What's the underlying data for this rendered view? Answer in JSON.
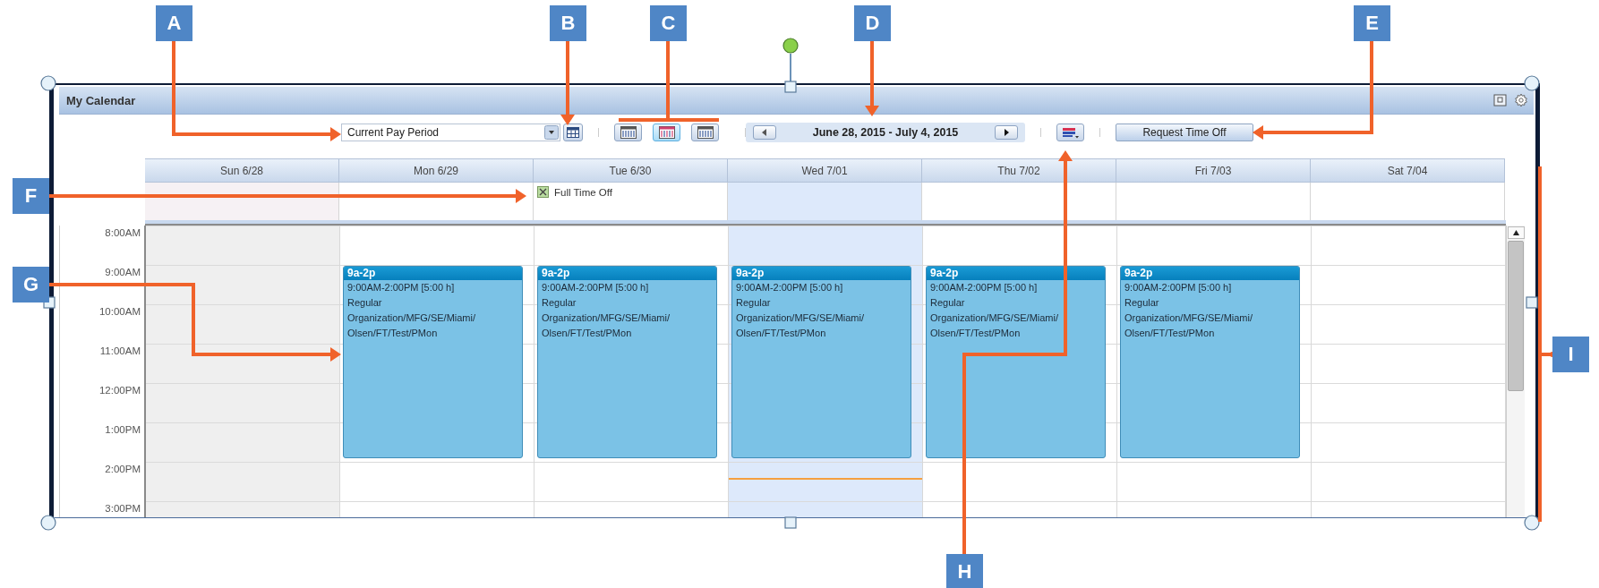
{
  "window": {
    "title": "My Calendar"
  },
  "toolbar": {
    "period_select": {
      "value": "Current Pay Period"
    },
    "view_buttons": [
      {
        "selected": false
      },
      {
        "selected": true
      },
      {
        "selected": false
      }
    ],
    "date_range": "June 28, 2015 - July 4, 2015",
    "request_button": "Request Time Off"
  },
  "calendar": {
    "days": [
      {
        "label": "Sun 6/28",
        "shaded": true,
        "selected": false
      },
      {
        "label": "Mon 6/29",
        "shaded": false,
        "selected": false,
        "events": [
          {
            "title": "9a-2p",
            "lines": [
              "9:00AM-2:00PM [5:00 h]",
              "Regular",
              "Organization/MFG/SE/Miami/",
              "Olsen/FT/Test/PMon"
            ]
          }
        ]
      },
      {
        "label": "Tue 6/30",
        "shaded": false,
        "selected": false,
        "all_day": [
          "Full Time Off"
        ],
        "events": [
          {
            "title": "9a-2p",
            "lines": [
              "9:00AM-2:00PM [5:00 h]",
              "Regular",
              "Organization/MFG/SE/Miami/",
              "Olsen/FT/Test/PMon"
            ]
          }
        ]
      },
      {
        "label": "Wed 7/01",
        "shaded": false,
        "selected": true,
        "events": [
          {
            "title": "9a-2p",
            "lines": [
              "9:00AM-2:00PM [5:00 h]",
              "Regular",
              "Organization/MFG/SE/Miami/",
              "Olsen/FT/Test/PMon"
            ]
          }
        ]
      },
      {
        "label": "Thu 7/02",
        "shaded": false,
        "selected": false,
        "events": [
          {
            "title": "9a-2p",
            "lines": [
              "9:00AM-2:00PM [5:00 h]",
              "Regular",
              "Organization/MFG/SE/Miami/",
              "Olsen/FT/Test/PMon"
            ]
          }
        ]
      },
      {
        "label": "Fri 7/03",
        "shaded": false,
        "selected": false,
        "events": [
          {
            "title": "9a-2p",
            "lines": [
              "9:00AM-2:00PM [5:00 h]",
              "Regular",
              "Organization/MFG/SE/Miami/",
              "Olsen/FT/Test/PMon"
            ]
          }
        ]
      },
      {
        "label": "Sat 7/04",
        "shaded": false,
        "selected": false
      }
    ],
    "hours": [
      "8:00AM",
      "9:00AM",
      "10:00AM",
      "11:00AM",
      "12:00PM",
      "1:00PM",
      "2:00PM",
      "3:00PM"
    ]
  },
  "callouts": [
    {
      "label": "A"
    },
    {
      "label": "B"
    },
    {
      "label": "C"
    },
    {
      "label": "D"
    },
    {
      "label": "E"
    },
    {
      "label": "F"
    },
    {
      "label": "G"
    },
    {
      "label": "H"
    },
    {
      "label": "I"
    }
  ]
}
